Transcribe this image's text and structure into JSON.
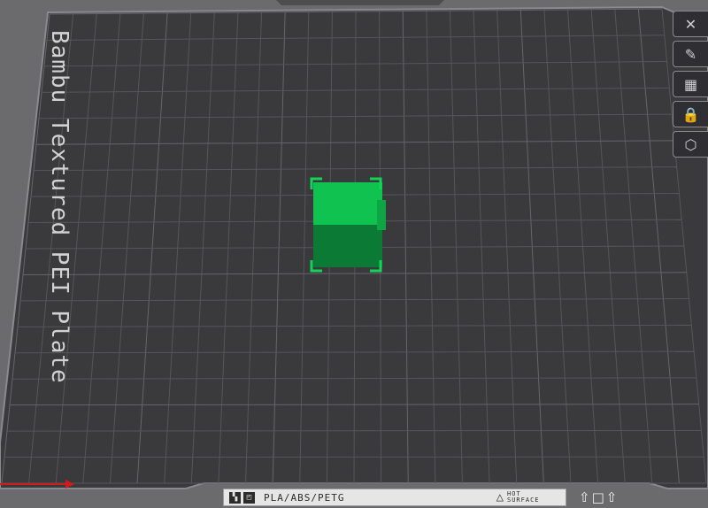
{
  "plate": {
    "title": "Bambu Textured PEI Plate",
    "filament_types": "PLA/ABS/PETG",
    "hot_surface_line1": "HOT",
    "hot_surface_line2": "SURFACE"
  },
  "right_toolbar": {
    "items": [
      {
        "name": "close",
        "glyph": "✕"
      },
      {
        "name": "arrange",
        "glyph": "✎"
      },
      {
        "name": "layout",
        "glyph": "▦"
      },
      {
        "name": "lock",
        "glyph": "🔒"
      },
      {
        "name": "settings",
        "glyph": "⬡"
      }
    ]
  },
  "colors": {
    "bed": "#3a3a3d",
    "grid": "#555558",
    "object_top": "#10c24f",
    "object_side": "#0a7a34",
    "axis_x": "#d11a1a"
  },
  "icons": {
    "strip_1": "plate-layout-icon",
    "strip_2": "plate-type-icon",
    "hot": "warning-triangle-icon"
  }
}
